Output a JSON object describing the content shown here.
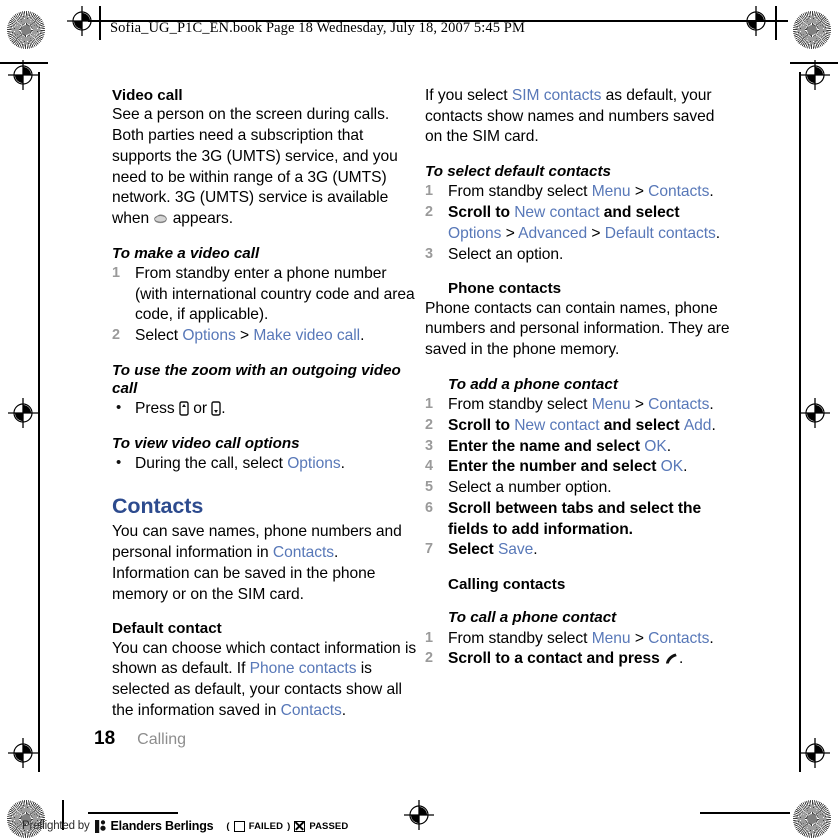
{
  "header": {
    "text": "Sofia_UG_P1C_EN.book  Page 18  Wednesday, July 18, 2007  5:45 PM"
  },
  "left_column": {
    "video_call": {
      "heading": "Video call",
      "body_part1": "See a person on the screen during calls. Both parties need a subscription that supports the 3G (UMTS) service, and you need to be within range of a 3G (UMTS) network. 3G (UMTS) service is available when",
      "body_part2": "appears.",
      "icon": "3g-umts-icon"
    },
    "make_video_call": {
      "heading": "To make a video call",
      "steps": [
        {
          "parts": [
            {
              "text": "From standby enter a phone number (with international country code and area code, if applicable).",
              "style": "plain"
            }
          ]
        },
        {
          "parts": [
            {
              "text": "Select ",
              "style": "plain"
            },
            {
              "text": "Options",
              "style": "link"
            },
            {
              "text": " > ",
              "style": "plain"
            },
            {
              "text": "Make video call",
              "style": "link"
            },
            {
              "text": ".",
              "style": "plain"
            }
          ]
        }
      ]
    },
    "zoom_outgoing": {
      "heading": "To use the zoom with an outgoing video call",
      "bullet_prefix": "Press",
      "bullet_middle": "or",
      "bullet_suffix": ".",
      "key_up_icon": "nav-key-up-icon",
      "key_down_icon": "nav-key-down-icon"
    },
    "view_options": {
      "heading": "To view video call options",
      "bullet_prefix": "During the call, select ",
      "bullet_link": "Options",
      "bullet_suffix": "."
    },
    "contacts": {
      "heading": "Contacts",
      "body_part1": "You can save names, phone numbers and personal information in ",
      "body_link": "Contacts",
      "body_part2": ". Information can be saved in the phone memory or on the SIM card."
    },
    "default_contact": {
      "heading": "Default contact",
      "body_part1": "You can choose which contact information is shown as default. If ",
      "body_link1": "Phone contacts",
      "body_part2": " is selected as default, your contacts show all the information saved in ",
      "body_link2": "Contacts",
      "body_part3": "."
    }
  },
  "right_column": {
    "sim_default": {
      "body_part1": "If you select ",
      "body_link": "SIM contacts",
      "body_part2": " as default, your contacts show names and numbers saved on the SIM card."
    },
    "select_default_contacts": {
      "heading": "To select default contacts",
      "steps": [
        {
          "parts": [
            {
              "text": "From standby select ",
              "style": "plain"
            },
            {
              "text": "Menu",
              "style": "link"
            },
            {
              "text": " > ",
              "style": "plain"
            },
            {
              "text": "Contacts",
              "style": "link"
            },
            {
              "text": ".",
              "style": "plain"
            }
          ]
        },
        {
          "parts": [
            {
              "text": "Scroll to ",
              "style": "bold"
            },
            {
              "text": "New contact",
              "style": "link"
            },
            {
              "text": " and select ",
              "style": "bold"
            },
            {
              "text": "Options",
              "style": "link"
            },
            {
              "text": " > ",
              "style": "plain"
            },
            {
              "text": "Advanced",
              "style": "link"
            },
            {
              "text": " > ",
              "style": "plain"
            },
            {
              "text": "Default contacts",
              "style": "link"
            },
            {
              "text": ".",
              "style": "plain"
            }
          ]
        },
        {
          "parts": [
            {
              "text": "Select an option.",
              "style": "plain"
            }
          ]
        }
      ]
    },
    "phone_contacts": {
      "heading": "Phone contacts",
      "body": "Phone contacts can contain names, phone numbers and personal information. They are saved in the phone memory."
    },
    "add_phone_contact": {
      "heading": "To add a phone contact",
      "steps": [
        {
          "parts": [
            {
              "text": "From standby select ",
              "style": "plain"
            },
            {
              "text": "Menu",
              "style": "link"
            },
            {
              "text": " > ",
              "style": "plain"
            },
            {
              "text": "Contacts",
              "style": "link"
            },
            {
              "text": ".",
              "style": "plain"
            }
          ]
        },
        {
          "parts": [
            {
              "text": "Scroll to ",
              "style": "bold"
            },
            {
              "text": "New contact",
              "style": "link"
            },
            {
              "text": " and select ",
              "style": "bold"
            },
            {
              "text": "Add",
              "style": "link"
            },
            {
              "text": ".",
              "style": "plain"
            }
          ]
        },
        {
          "parts": [
            {
              "text": "Enter the name and select ",
              "style": "bold"
            },
            {
              "text": "OK",
              "style": "link"
            },
            {
              "text": ".",
              "style": "plain"
            }
          ]
        },
        {
          "parts": [
            {
              "text": "Enter the number and select ",
              "style": "bold"
            },
            {
              "text": "OK",
              "style": "link"
            },
            {
              "text": ".",
              "style": "plain"
            }
          ]
        },
        {
          "parts": [
            {
              "text": "Select a number option.",
              "style": "plain"
            }
          ]
        },
        {
          "parts": [
            {
              "text": "Scroll between tabs and select the fields to add information.",
              "style": "bold"
            }
          ]
        },
        {
          "parts": [
            {
              "text": "Select ",
              "style": "bold"
            },
            {
              "text": "Save",
              "style": "link"
            },
            {
              "text": ".",
              "style": "plain"
            }
          ]
        }
      ]
    },
    "calling_contacts": {
      "heading": "Calling contacts"
    },
    "call_phone_contact": {
      "heading": "To call a phone contact",
      "steps": [
        {
          "parts": [
            {
              "text": "From standby select ",
              "style": "plain"
            },
            {
              "text": "Menu",
              "style": "link"
            },
            {
              "text": " > ",
              "style": "plain"
            },
            {
              "text": "Contacts",
              "style": "link"
            },
            {
              "text": ".",
              "style": "plain"
            }
          ]
        },
        {
          "parts": [
            {
              "text": "Scroll to a contact and press ",
              "style": "bold"
            },
            {
              "text": "",
              "style": "icon",
              "icon": "call-key-icon"
            },
            {
              "text": ".",
              "style": "plain"
            }
          ]
        }
      ]
    }
  },
  "footer": {
    "page_number": "18",
    "chapter": "Calling"
  },
  "preflight": {
    "label": "Preflighted by",
    "company": "Elanders Berlings",
    "failed_open": "(",
    "failed_label": "FAILED",
    "failed_close": ")",
    "passed_label": "PASSED"
  },
  "colors": {
    "link": "#5878b8",
    "heading": "#2d4b8e",
    "step_number": "#9a9a9a",
    "chapter": "#8d8d8d"
  }
}
